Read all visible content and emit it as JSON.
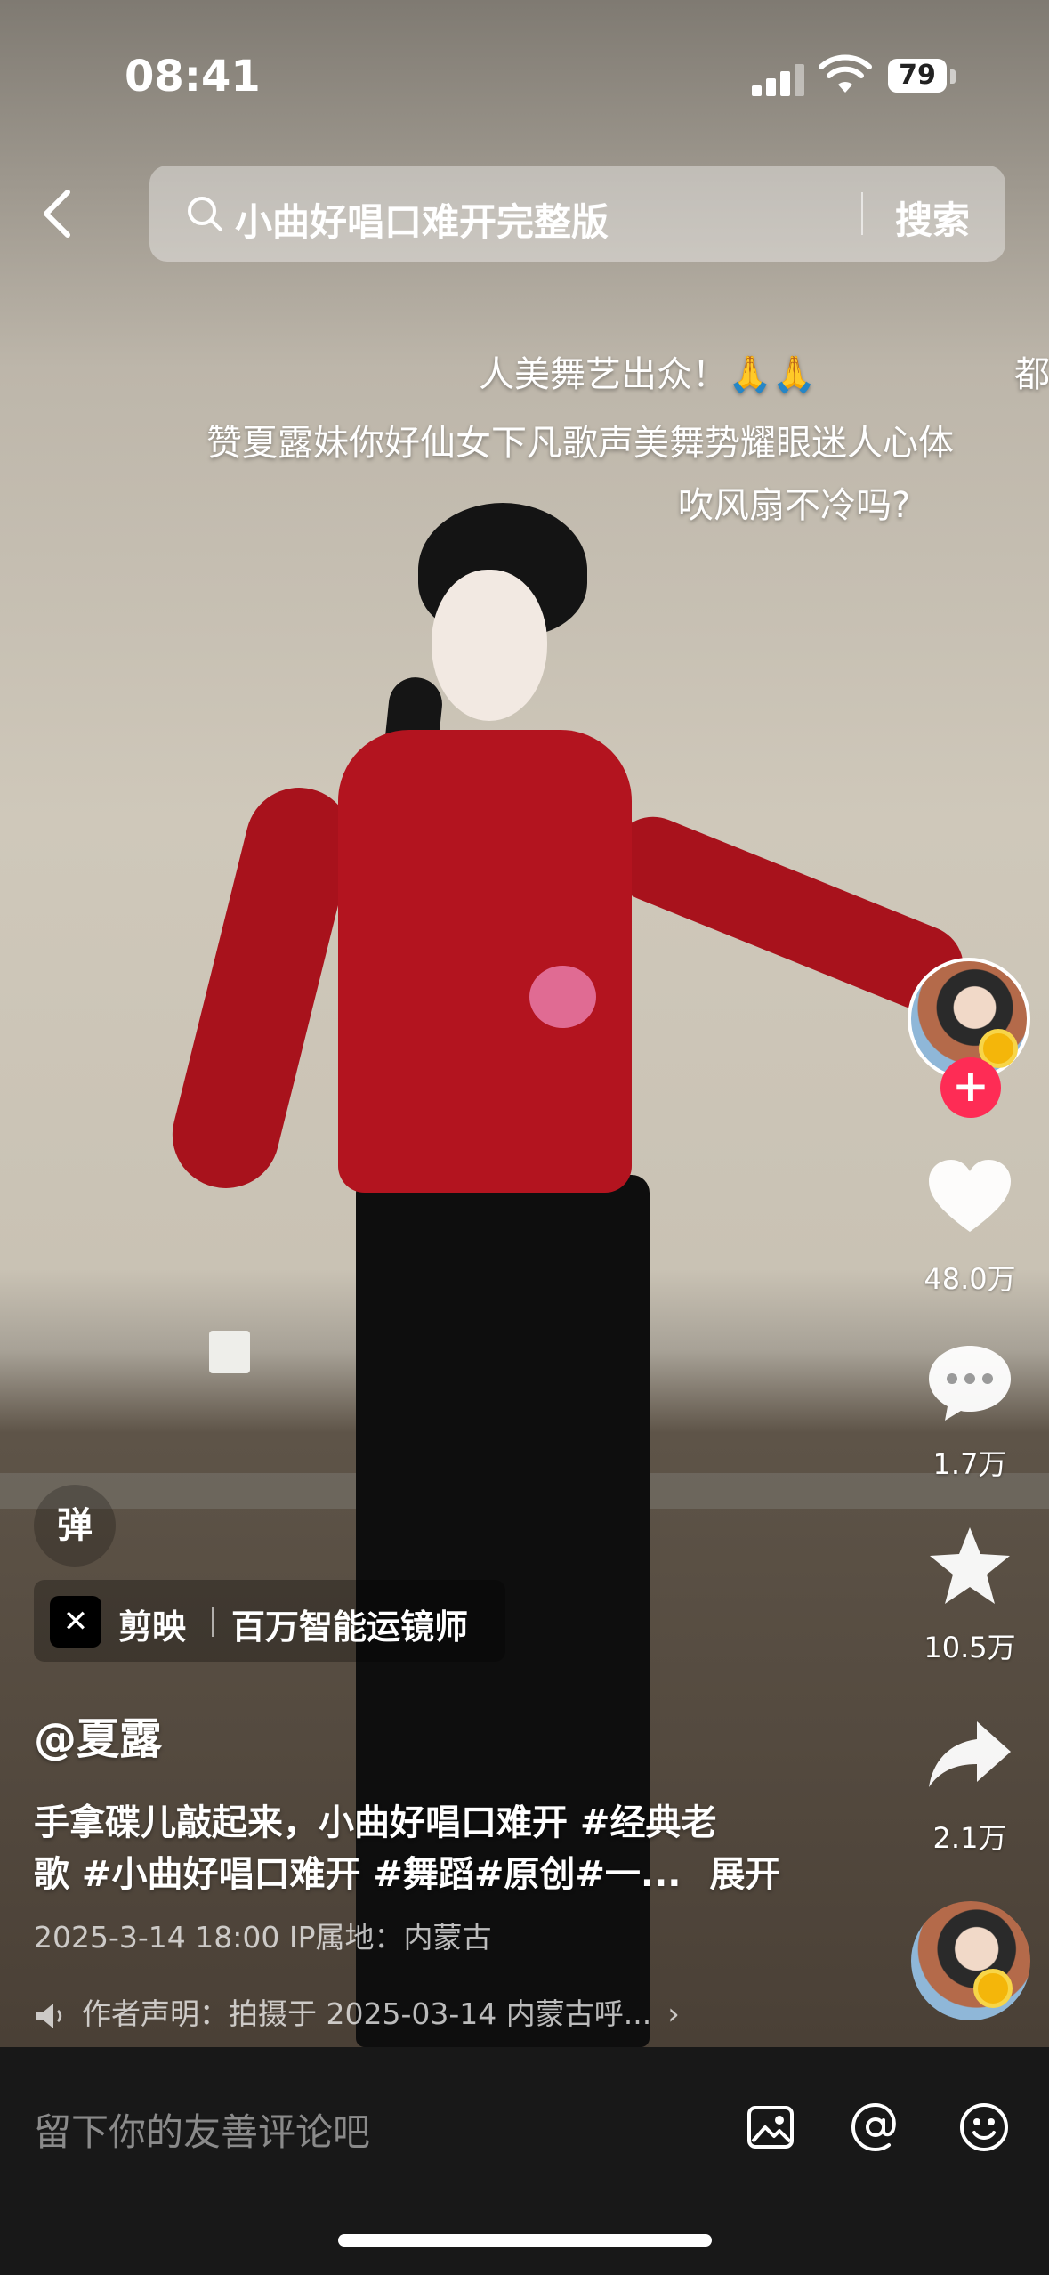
{
  "status_bar": {
    "time": "08:41",
    "battery": "79"
  },
  "search": {
    "query": "小曲好唱口难开完整版",
    "button_label": "搜索"
  },
  "danmaku": [
    "人美舞艺出众！🙏🙏",
    "都",
    "赞夏露妹你好仙女下凡歌声美舞势耀眼迷人心体",
    "吹风扇不冷吗?"
  ],
  "right_rail": {
    "like_count": "48.0万",
    "comment_count": "1.7万",
    "favorite_count": "10.5万",
    "share_count": "2.1万"
  },
  "danmu_toggle_label": "弹",
  "capcut": {
    "name": "剪映",
    "desc": "百万智能运镜师"
  },
  "post": {
    "author": "@夏露",
    "caption_line1": "手拿碟儿敲起来，小曲好唱口难开 #经典老",
    "caption_line2": "歌 #小曲好唱口难开 #舞蹈#原创#一...",
    "expand_label": "展开",
    "meta": "2025-3-14 18:00   IP属地：内蒙古",
    "declaration": "作者声明：拍摄于 2025-03-14 内蒙古呼..."
  },
  "comment_bar": {
    "placeholder": "留下你的友善评论吧"
  }
}
